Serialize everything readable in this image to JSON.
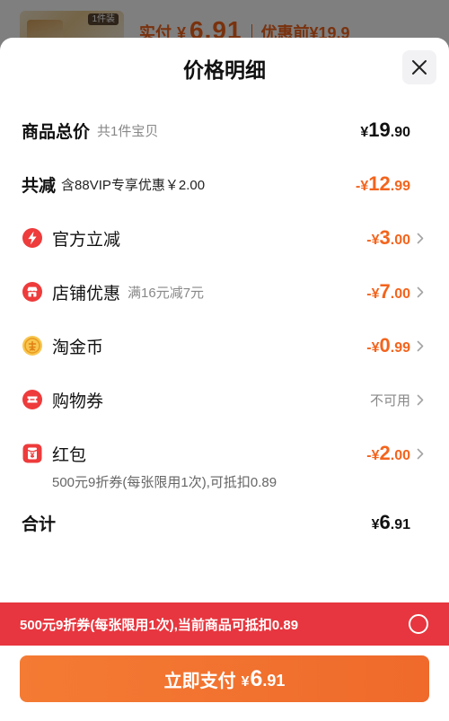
{
  "colors": {
    "accent_orange": "#f3641d",
    "banner_red": "#e7363f",
    "icon_red": "#ee3b3b",
    "coin_gold": "#f7c64f",
    "button_orange_start": "#f47b33",
    "button_orange_end": "#ef6a2b"
  },
  "background": {
    "thumbnail_tag": "1件装",
    "paid_label": "实付",
    "paid_currency": "¥",
    "paid_amount": "6.91",
    "original_price": "优惠前¥19.9"
  },
  "sheet": {
    "title": "价格明细",
    "close_icon": "close-icon"
  },
  "rows": {
    "subtotal": {
      "label": "商品总价",
      "note": "共1件宝贝",
      "amount": {
        "prefix": "¥",
        "int": "19",
        "dec": ".90"
      }
    },
    "total_reduction": {
      "label": "共减",
      "note": "含88VIP专享优惠￥2.00",
      "amount": {
        "prefix": "-¥",
        "int": "12",
        "dec": ".99"
      }
    },
    "official_discount": {
      "icon": "lightning-icon",
      "label": "官方立减",
      "amount": {
        "prefix": "-¥",
        "int": "3",
        "dec": ".00"
      }
    },
    "shop_discount": {
      "icon": "shop-icon",
      "label": "店铺优惠",
      "note": "满16元减7元",
      "amount": {
        "prefix": "-¥",
        "int": "7",
        "dec": ".00"
      }
    },
    "taobao_coins": {
      "icon": "coin-icon",
      "label": "淘金币",
      "amount": {
        "prefix": "-¥",
        "int": "0",
        "dec": ".99"
      }
    },
    "shopping_voucher": {
      "icon": "ticket-icon",
      "label": "购物券",
      "status": "不可用"
    },
    "red_packet": {
      "icon": "red-packet-icon",
      "label": "红包",
      "amount": {
        "prefix": "-¥",
        "int": "2",
        "dec": ".00"
      },
      "detail": "500元9折券(每张限用1次),可抵扣0.89"
    },
    "total": {
      "label": "合计",
      "amount": {
        "prefix": "¥",
        "int": "6",
        "dec": ".91"
      }
    }
  },
  "coupon_banner": {
    "text": "500元9折券(每张限用1次),当前商品可抵扣0.89",
    "selected": false
  },
  "pay_button": {
    "label": "立即支付",
    "prefix": "¥",
    "int": "6",
    "dec": ".91"
  }
}
